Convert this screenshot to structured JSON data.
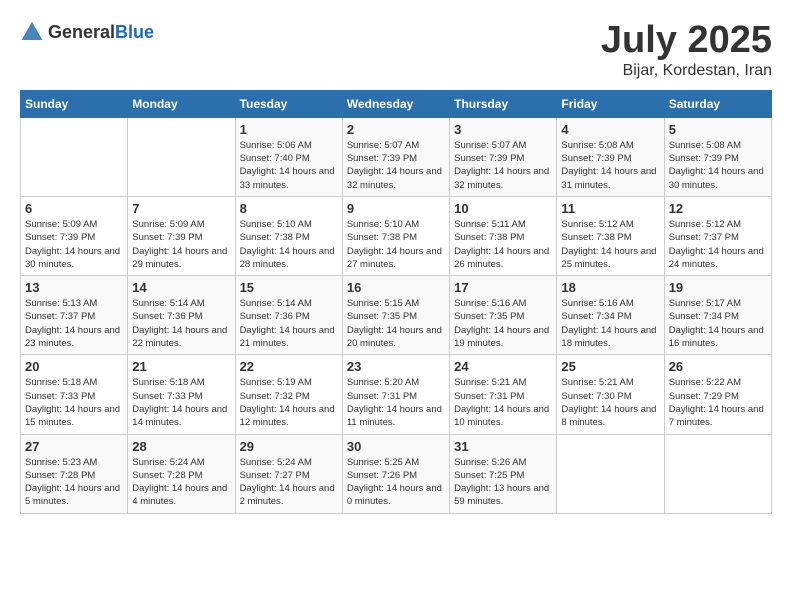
{
  "header": {
    "logo_general": "General",
    "logo_blue": "Blue",
    "month_title": "July 2025",
    "location": "Bijar, Kordestan, Iran"
  },
  "weekdays": [
    "Sunday",
    "Monday",
    "Tuesday",
    "Wednesday",
    "Thursday",
    "Friday",
    "Saturday"
  ],
  "weeks": [
    [
      {
        "day": "",
        "sunrise": "",
        "sunset": "",
        "daylight": ""
      },
      {
        "day": "",
        "sunrise": "",
        "sunset": "",
        "daylight": ""
      },
      {
        "day": "1",
        "sunrise": "Sunrise: 5:06 AM",
        "sunset": "Sunset: 7:40 PM",
        "daylight": "Daylight: 14 hours and 33 minutes."
      },
      {
        "day": "2",
        "sunrise": "Sunrise: 5:07 AM",
        "sunset": "Sunset: 7:39 PM",
        "daylight": "Daylight: 14 hours and 32 minutes."
      },
      {
        "day": "3",
        "sunrise": "Sunrise: 5:07 AM",
        "sunset": "Sunset: 7:39 PM",
        "daylight": "Daylight: 14 hours and 32 minutes."
      },
      {
        "day": "4",
        "sunrise": "Sunrise: 5:08 AM",
        "sunset": "Sunset: 7:39 PM",
        "daylight": "Daylight: 14 hours and 31 minutes."
      },
      {
        "day": "5",
        "sunrise": "Sunrise: 5:08 AM",
        "sunset": "Sunset: 7:39 PM",
        "daylight": "Daylight: 14 hours and 30 minutes."
      }
    ],
    [
      {
        "day": "6",
        "sunrise": "Sunrise: 5:09 AM",
        "sunset": "Sunset: 7:39 PM",
        "daylight": "Daylight: 14 hours and 30 minutes."
      },
      {
        "day": "7",
        "sunrise": "Sunrise: 5:09 AM",
        "sunset": "Sunset: 7:39 PM",
        "daylight": "Daylight: 14 hours and 29 minutes."
      },
      {
        "day": "8",
        "sunrise": "Sunrise: 5:10 AM",
        "sunset": "Sunset: 7:38 PM",
        "daylight": "Daylight: 14 hours and 28 minutes."
      },
      {
        "day": "9",
        "sunrise": "Sunrise: 5:10 AM",
        "sunset": "Sunset: 7:38 PM",
        "daylight": "Daylight: 14 hours and 27 minutes."
      },
      {
        "day": "10",
        "sunrise": "Sunrise: 5:11 AM",
        "sunset": "Sunset: 7:38 PM",
        "daylight": "Daylight: 14 hours and 26 minutes."
      },
      {
        "day": "11",
        "sunrise": "Sunrise: 5:12 AM",
        "sunset": "Sunset: 7:38 PM",
        "daylight": "Daylight: 14 hours and 25 minutes."
      },
      {
        "day": "12",
        "sunrise": "Sunrise: 5:12 AM",
        "sunset": "Sunset: 7:37 PM",
        "daylight": "Daylight: 14 hours and 24 minutes."
      }
    ],
    [
      {
        "day": "13",
        "sunrise": "Sunrise: 5:13 AM",
        "sunset": "Sunset: 7:37 PM",
        "daylight": "Daylight: 14 hours and 23 minutes."
      },
      {
        "day": "14",
        "sunrise": "Sunrise: 5:14 AM",
        "sunset": "Sunset: 7:36 PM",
        "daylight": "Daylight: 14 hours and 22 minutes."
      },
      {
        "day": "15",
        "sunrise": "Sunrise: 5:14 AM",
        "sunset": "Sunset: 7:36 PM",
        "daylight": "Daylight: 14 hours and 21 minutes."
      },
      {
        "day": "16",
        "sunrise": "Sunrise: 5:15 AM",
        "sunset": "Sunset: 7:35 PM",
        "daylight": "Daylight: 14 hours and 20 minutes."
      },
      {
        "day": "17",
        "sunrise": "Sunrise: 5:16 AM",
        "sunset": "Sunset: 7:35 PM",
        "daylight": "Daylight: 14 hours and 19 minutes."
      },
      {
        "day": "18",
        "sunrise": "Sunrise: 5:16 AM",
        "sunset": "Sunset: 7:34 PM",
        "daylight": "Daylight: 14 hours and 18 minutes."
      },
      {
        "day": "19",
        "sunrise": "Sunrise: 5:17 AM",
        "sunset": "Sunset: 7:34 PM",
        "daylight": "Daylight: 14 hours and 16 minutes."
      }
    ],
    [
      {
        "day": "20",
        "sunrise": "Sunrise: 5:18 AM",
        "sunset": "Sunset: 7:33 PM",
        "daylight": "Daylight: 14 hours and 15 minutes."
      },
      {
        "day": "21",
        "sunrise": "Sunrise: 5:18 AM",
        "sunset": "Sunset: 7:33 PM",
        "daylight": "Daylight: 14 hours and 14 minutes."
      },
      {
        "day": "22",
        "sunrise": "Sunrise: 5:19 AM",
        "sunset": "Sunset: 7:32 PM",
        "daylight": "Daylight: 14 hours and 12 minutes."
      },
      {
        "day": "23",
        "sunrise": "Sunrise: 5:20 AM",
        "sunset": "Sunset: 7:31 PM",
        "daylight": "Daylight: 14 hours and 11 minutes."
      },
      {
        "day": "24",
        "sunrise": "Sunrise: 5:21 AM",
        "sunset": "Sunset: 7:31 PM",
        "daylight": "Daylight: 14 hours and 10 minutes."
      },
      {
        "day": "25",
        "sunrise": "Sunrise: 5:21 AM",
        "sunset": "Sunset: 7:30 PM",
        "daylight": "Daylight: 14 hours and 8 minutes."
      },
      {
        "day": "26",
        "sunrise": "Sunrise: 5:22 AM",
        "sunset": "Sunset: 7:29 PM",
        "daylight": "Daylight: 14 hours and 7 minutes."
      }
    ],
    [
      {
        "day": "27",
        "sunrise": "Sunrise: 5:23 AM",
        "sunset": "Sunset: 7:28 PM",
        "daylight": "Daylight: 14 hours and 5 minutes."
      },
      {
        "day": "28",
        "sunrise": "Sunrise: 5:24 AM",
        "sunset": "Sunset: 7:28 PM",
        "daylight": "Daylight: 14 hours and 4 minutes."
      },
      {
        "day": "29",
        "sunrise": "Sunrise: 5:24 AM",
        "sunset": "Sunset: 7:27 PM",
        "daylight": "Daylight: 14 hours and 2 minutes."
      },
      {
        "day": "30",
        "sunrise": "Sunrise: 5:25 AM",
        "sunset": "Sunset: 7:26 PM",
        "daylight": "Daylight: 14 hours and 0 minutes."
      },
      {
        "day": "31",
        "sunrise": "Sunrise: 5:26 AM",
        "sunset": "Sunset: 7:25 PM",
        "daylight": "Daylight: 13 hours and 59 minutes."
      },
      {
        "day": "",
        "sunrise": "",
        "sunset": "",
        "daylight": ""
      },
      {
        "day": "",
        "sunrise": "",
        "sunset": "",
        "daylight": ""
      }
    ]
  ]
}
